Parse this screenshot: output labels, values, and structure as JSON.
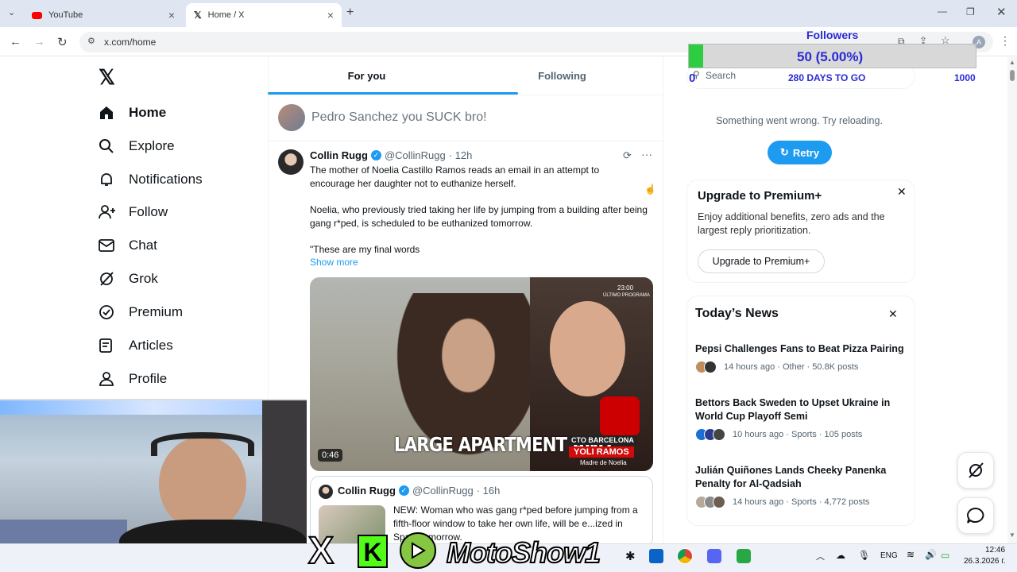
{
  "browser": {
    "tabs": [
      {
        "label": "YouTube"
      },
      {
        "label": "Home / X"
      }
    ],
    "url": "x.com/home"
  },
  "sidebar": {
    "items": [
      {
        "label": "Home"
      },
      {
        "label": "Explore"
      },
      {
        "label": "Notifications"
      },
      {
        "label": "Follow"
      },
      {
        "label": "Chat"
      },
      {
        "label": "Grok"
      },
      {
        "label": "Premium"
      },
      {
        "label": "Articles"
      },
      {
        "label": "Profile"
      }
    ]
  },
  "feed": {
    "tabs": [
      {
        "label": "For you"
      },
      {
        "label": "Following"
      }
    ],
    "compose_text": "Pedro Sanchez you SUCK bro!",
    "tweet": {
      "name": "Collin Rugg",
      "handle": "@CollinRugg",
      "time": "· 12h",
      "para1": "The mother of Noelia Castillo Ramos reads an email in an attempt to encourage her daughter not to euthanize herself.",
      "para2": "Noelia, who previously tried taking her life by jumping from a building after being gang r*ped, is scheduled to be euthanized tomorrow.",
      "para3": "\"These are my final words",
      "show_more": "Show more",
      "video_caption": "LARGE APARTMENT AND",
      "video_duration": "0:46",
      "overlay_name": "YOLI RAMOS",
      "overlay_sub": "Madre de Noelia",
      "overlay_loc": "CTO BARCELONA",
      "overlay_time": "23:00",
      "overlay_prog": "ÚLTIMO PROGRAMA"
    },
    "quoted": {
      "name": "Collin Rugg",
      "handle": "@CollinRugg",
      "time": "· 16h",
      "text": "NEW: Woman who was gang r*ped before jumping from a fifth-floor window to take her own life, will be e...ized in Spain tomorrow."
    }
  },
  "overlay_widget": {
    "title": "Followers",
    "value": "50 (5.00%)",
    "progress": 0.05,
    "min": "0",
    "max": "1000",
    "days": "280 DAYS TO GO",
    "search_placeholder": "Search"
  },
  "right": {
    "error_text": "Something went wrong. Try reloading.",
    "retry_label": "Retry",
    "premium": {
      "title": "Upgrade to Premium+",
      "desc": "Enjoy additional benefits, zero ads and the largest reply prioritization.",
      "button": "Upgrade to Premium+"
    },
    "news": {
      "title": "Today’s News",
      "items": [
        {
          "title": "Pepsi Challenges Fans to Beat Pizza Pairing",
          "meta": "14 hours ago · Other · 50.8K posts"
        },
        {
          "title": "Bettors Back Sweden to Upset Ukraine in World Cup Playoff Semi",
          "meta": "10 hours ago · Sports · 105 posts"
        },
        {
          "title": "Julián Quiñones Lands Cheeky Panenka Penalty for Al-Qadsiah",
          "meta": "14 hours ago · Sports · 4,772 posts"
        }
      ]
    }
  },
  "stream_overlay": {
    "channel_name": "MotoShow1"
  },
  "taskbar": {
    "lang": "ENG",
    "time": "12:46",
    "date": "26.3.2026 г."
  },
  "colors": {
    "accent": "#1d9bf0",
    "progress_green": "#2ecc40",
    "widget_text": "#2b2bd6"
  }
}
